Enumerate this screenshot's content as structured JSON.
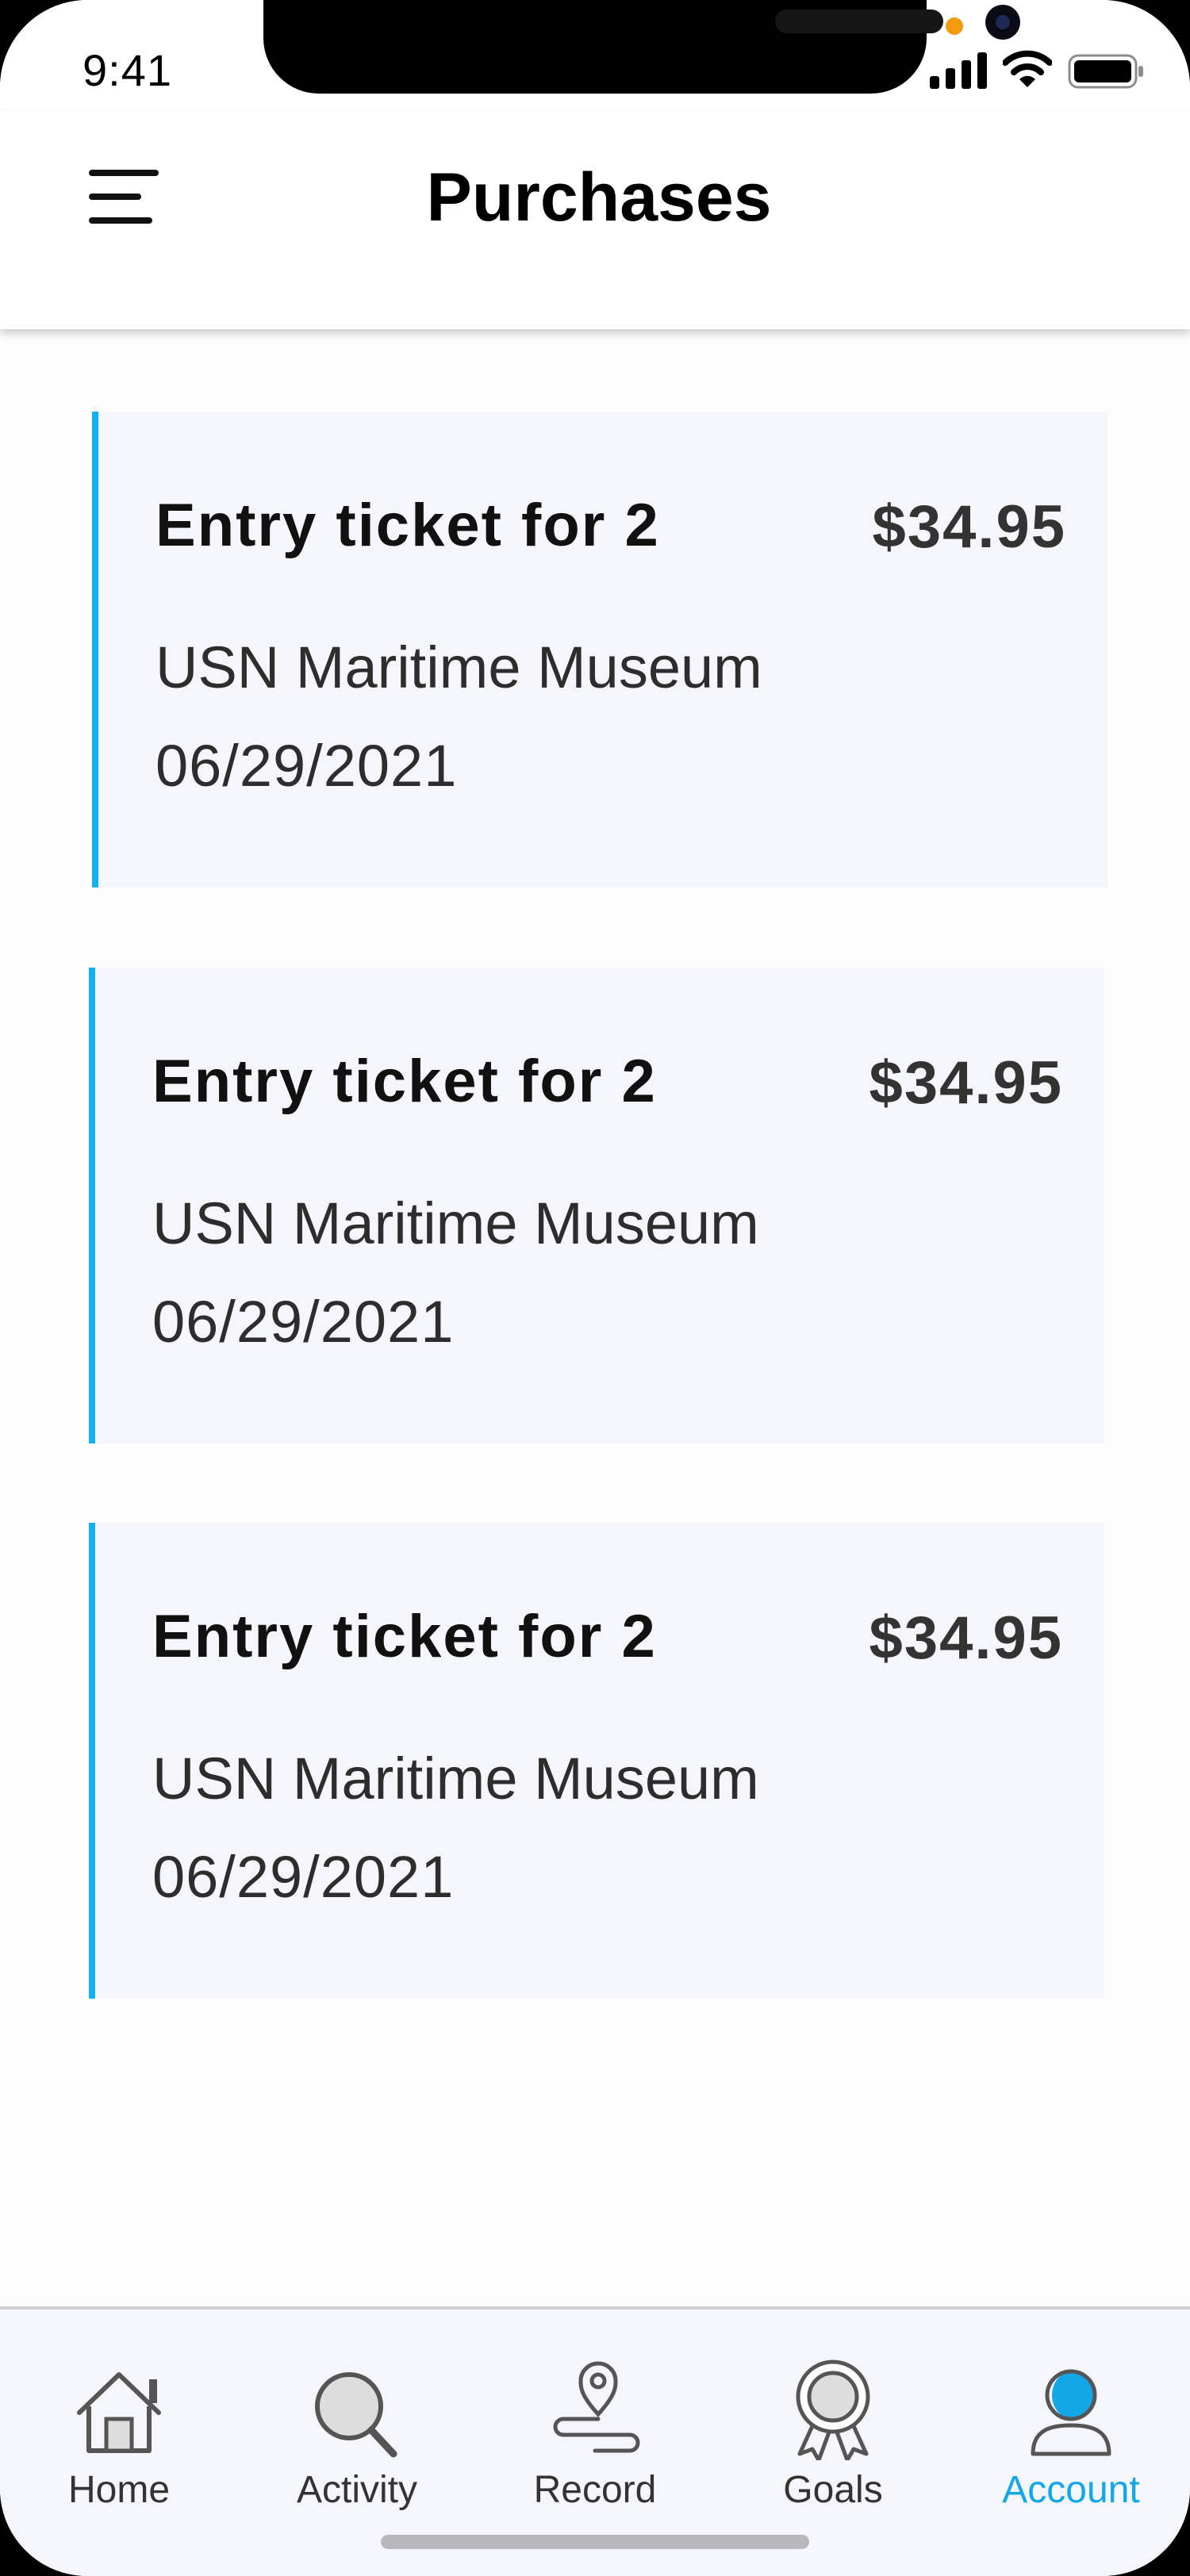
{
  "status_bar": {
    "time": "9:41",
    "icons": [
      "signal-icon",
      "wifi-icon",
      "battery-icon"
    ]
  },
  "header": {
    "title": "Purchases",
    "menu_icon": "hamburger-menu-icon"
  },
  "purchases": [
    {
      "title": "Entry ticket for 2",
      "price": "$34.95",
      "venue": "USN Maritime Museum",
      "date": "06/29/2021"
    },
    {
      "title": "Entry ticket for 2",
      "price": "$34.95",
      "venue": "USN Maritime Museum",
      "date": "06/29/2021"
    },
    {
      "title": "Entry ticket for 2",
      "price": "$34.95",
      "venue": "USN Maritime Museum",
      "date": "06/29/2021"
    }
  ],
  "tabs": [
    {
      "label": "Home",
      "icon": "home-icon",
      "active": false
    },
    {
      "label": "Activity",
      "icon": "magnifier-icon",
      "active": false
    },
    {
      "label": "Record",
      "icon": "map-pin-route-icon",
      "active": false
    },
    {
      "label": "Goals",
      "icon": "award-ribbon-icon",
      "active": false
    },
    {
      "label": "Account",
      "icon": "user-icon",
      "active": true
    }
  ],
  "colors": {
    "accent": "#13b1ed",
    "card_background": "#f5f6fb",
    "tab_active": "#13a7e8"
  }
}
